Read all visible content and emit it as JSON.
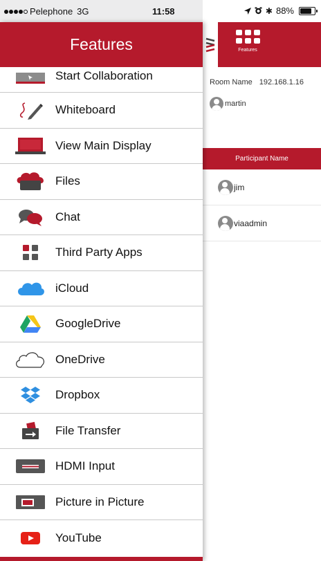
{
  "status_bar": {
    "carrier": "Pelephone",
    "network": "3G",
    "time": "11:58",
    "battery": "88%",
    "battery_level": 0.88
  },
  "drawer": {
    "title": "Features",
    "items": [
      {
        "label": "Start Collaboration",
        "icon": "start-collaboration-icon"
      },
      {
        "label": "Whiteboard",
        "icon": "whiteboard-pen-icon"
      },
      {
        "label": "View Main Display",
        "icon": "laptop-display-icon"
      },
      {
        "label": "Files",
        "icon": "cloud-folder-icon"
      },
      {
        "label": "Chat",
        "icon": "chat-bubbles-icon"
      },
      {
        "label": "Third Party Apps",
        "icon": "apps-grid-icon"
      },
      {
        "label": "iCloud",
        "icon": "icloud-icon"
      },
      {
        "label": "GoogleDrive",
        "icon": "google-drive-icon"
      },
      {
        "label": "OneDrive",
        "icon": "onedrive-icon"
      },
      {
        "label": "Dropbox",
        "icon": "dropbox-icon"
      },
      {
        "label": "File Transfer",
        "icon": "file-transfer-icon"
      },
      {
        "label": "HDMI Input",
        "icon": "hdmi-input-icon"
      },
      {
        "label": "Picture in Picture",
        "icon": "picture-in-picture-icon"
      },
      {
        "label": "YouTube",
        "icon": "youtube-icon"
      }
    ]
  },
  "main": {
    "features_caption": "Features",
    "room_label": "Room Name",
    "room_value": "192.168.1.16",
    "host_user": "martin",
    "participant_header": "Participant Name",
    "participants": [
      "jim",
      "viaadmin"
    ]
  },
  "colors": {
    "brand_red": "#b51a2c",
    "divider": "#c8c8c8"
  }
}
